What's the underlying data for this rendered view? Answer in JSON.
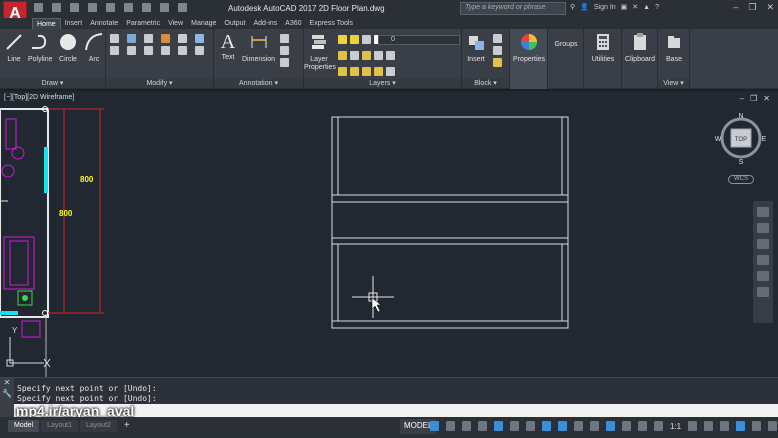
{
  "app": {
    "title": "Autodesk AutoCAD 2017    2D Floor Plan.dwg",
    "logo": "A",
    "search_placeholder": "Type a keyword or phrase",
    "sign_in": "Sign In"
  },
  "ribbon_tabs": [
    "Home",
    "Insert",
    "Annotate",
    "Parametric",
    "View",
    "Manage",
    "Output",
    "Add-ins",
    "A360",
    "Express Tools"
  ],
  "ribbon": {
    "draw": {
      "title": "Draw ▾",
      "tools": [
        "Line",
        "Polyline",
        "Circle",
        "Arc"
      ]
    },
    "modify": {
      "title": "Modify ▾"
    },
    "annotation": {
      "title": "Annotation ▾",
      "tools": [
        "Text",
        "Dimension"
      ]
    },
    "layers": {
      "title": "Layers ▾",
      "layer_properties": "Layer\nProperties",
      "current_layer": "0"
    },
    "block": {
      "title": "Block ▾",
      "insert": "Insert"
    },
    "properties": "Properties",
    "groups": "Groups",
    "utilities": "Utilities",
    "clipboard": "Clipboard",
    "view": {
      "base": "Base",
      "title": "View ▾"
    }
  },
  "viewport": {
    "label": "[−][Top][2D Wireframe]",
    "viewcube": {
      "top": "TOP",
      "north": "N",
      "south": "S",
      "east": "E",
      "west": "W",
      "wcs": "WCS"
    },
    "dimension_labels": [
      "800",
      "800"
    ],
    "ucs_y": "Y"
  },
  "command": {
    "history": [
      "Specify next point or [Undo]:",
      "Specify next point or [Undo]:"
    ],
    "watermark": "mp4.ir/aryan_aval"
  },
  "status": {
    "layout_tabs": [
      "Model",
      "Layout1",
      "Layout2"
    ],
    "add": "+",
    "model_button": "MODEL",
    "scale": "1:1"
  },
  "colors": {
    "accent": "#3a8fd8",
    "drawing_lines": "#d9dde2",
    "dimension_red": "#d2232a",
    "furniture_magenta": "#d21ad6",
    "dimension_text": "#ffff00",
    "window_cyan": "#15e4ef"
  }
}
